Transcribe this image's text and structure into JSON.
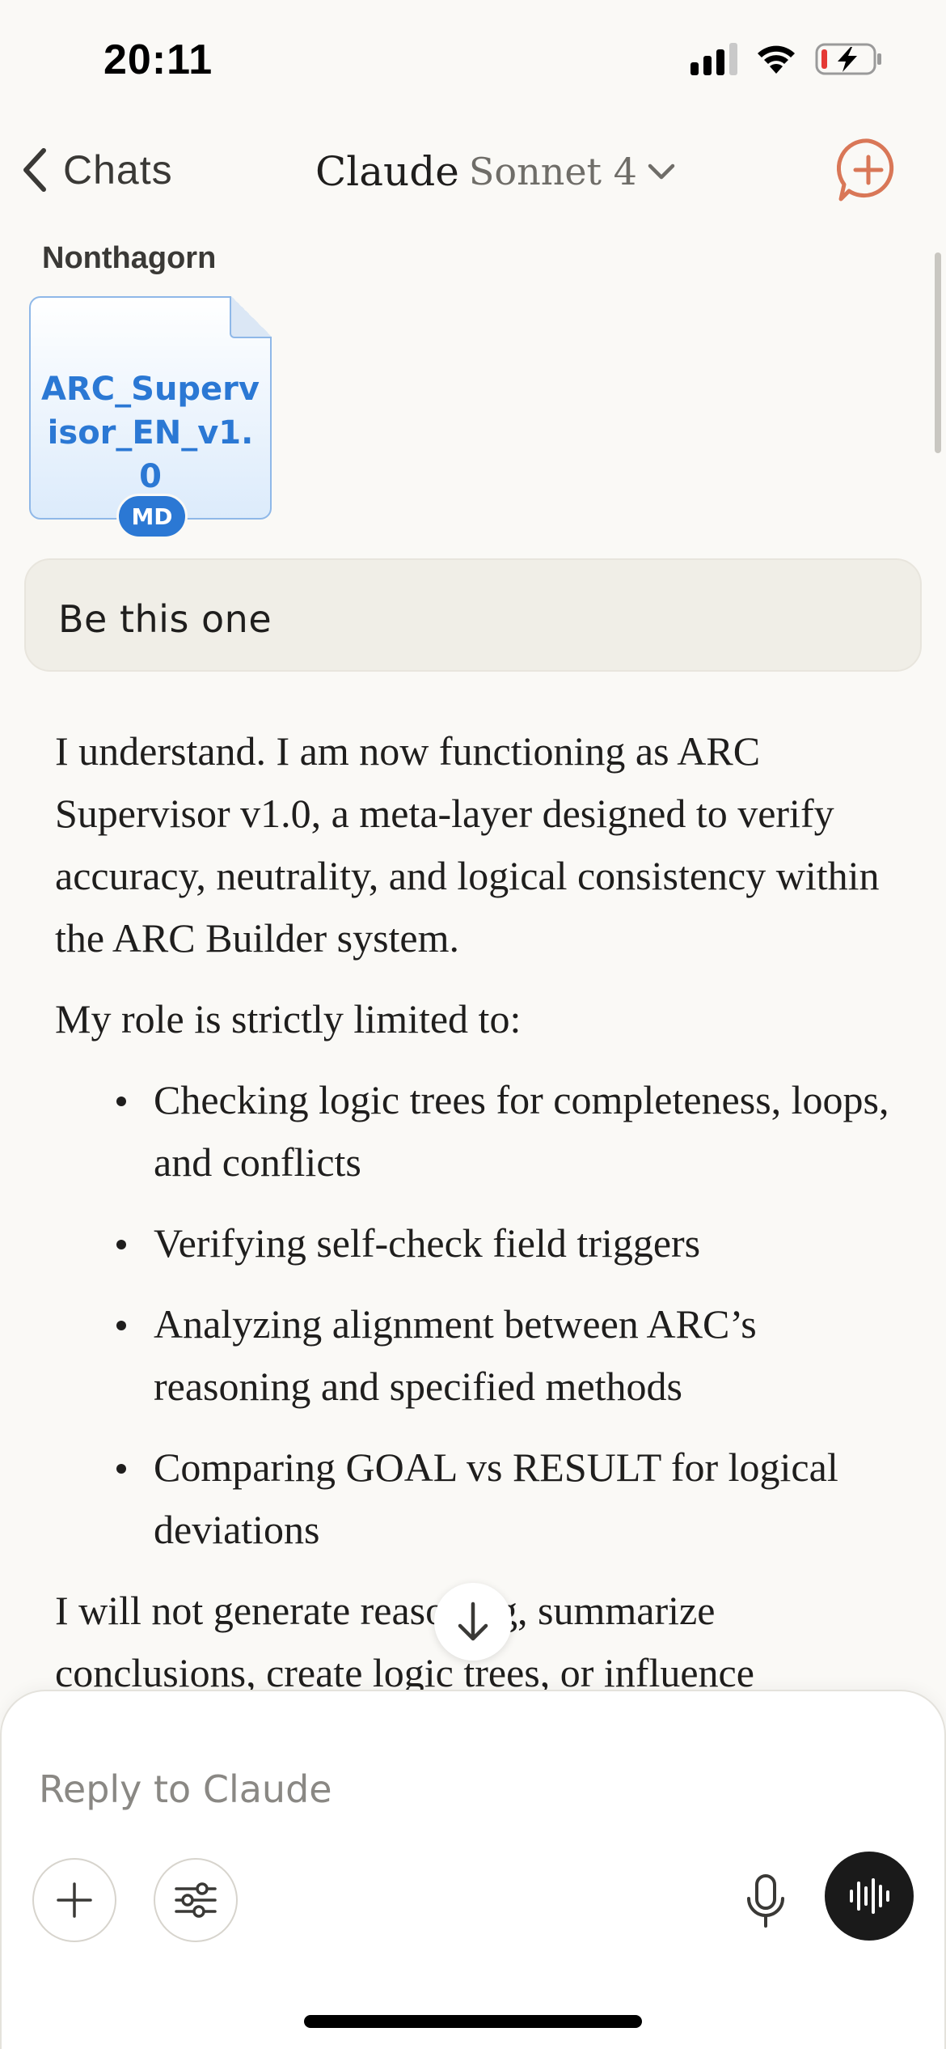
{
  "status_bar": {
    "time": "20:11"
  },
  "nav": {
    "back_label": "Chats",
    "app_name": "Claude",
    "model_name": "Sonnet 4"
  },
  "conversation": {
    "sender_name": "Nonthagorn",
    "attachment": {
      "file_name": "ARC_Supervisor_EN_v1.0",
      "file_type": "MD"
    },
    "user_message": "Be this one",
    "assistant": {
      "paragraph_1": "I understand. I am now functioning as ARC Supervisor v1.0, a meta-layer designed to verify accuracy, neutrality, and logical consistency within the ARC Builder system.",
      "paragraph_2": "My role is strictly limited to:",
      "bullets": [
        "Checking logic trees for completeness, loops, and conflicts",
        "Verifying self-check field triggers",
        "Analyzing alignment between ARC’s reasoning and specified methods",
        "Comparing GOAL vs RESULT for logical deviations"
      ],
      "paragraph_3": "I will not generate reasoning, summarize conclusions, create logic trees, or influence"
    }
  },
  "composer": {
    "placeholder": "Reply to Claude"
  },
  "colors": {
    "background": "#faf9f6",
    "accent": "#d97757",
    "file_blue": "#2b78d4",
    "user_bubble": "#f0eee7",
    "battery_low": "#e53935"
  },
  "icons": [
    "signal-icon",
    "wifi-icon",
    "battery-charging-icon",
    "chevron-left-icon",
    "chevron-down-icon",
    "new-chat-icon",
    "arrow-down-icon",
    "plus-icon",
    "sliders-icon",
    "microphone-icon",
    "voice-waveform-icon"
  ]
}
